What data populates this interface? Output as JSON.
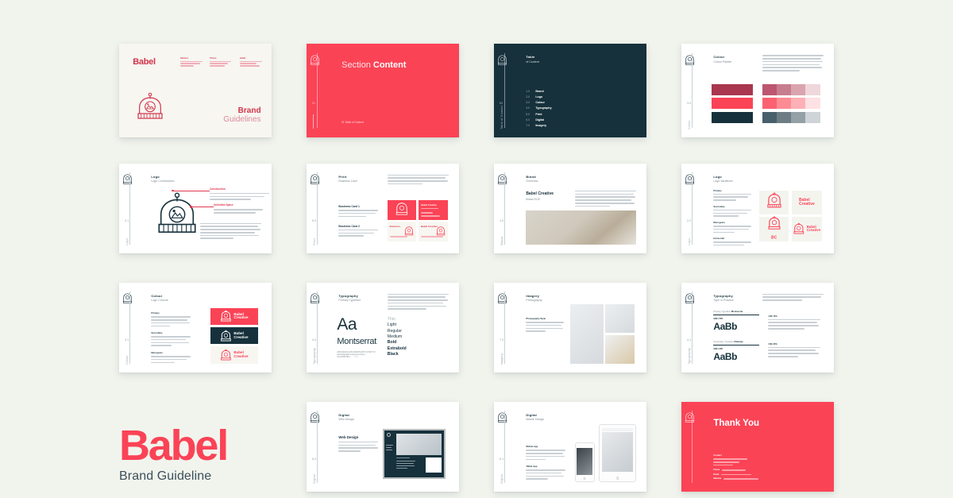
{
  "page": {
    "background": "#f1f4ed",
    "accent_red": "#fb4356",
    "accent_maroon": "#a9374f",
    "accent_navy": "#16313c"
  },
  "footer": {
    "brand": "Babel",
    "subtitle": "Brand Guideline"
  },
  "slides": {
    "cover": {
      "brand": "Babel",
      "title_line1": "Brand",
      "title_line2": "Guidelines",
      "columns": [
        {
          "label": "Address"
        },
        {
          "label": "Phone"
        },
        {
          "label": "Email"
        }
      ]
    },
    "section": {
      "title_light": "Section ",
      "title_bold": "Content",
      "footer": "01 Table of Content",
      "number": "01"
    },
    "toc": {
      "heading_line1": "Table",
      "heading_line2": "of Content",
      "number": "01",
      "vertical_label": "Table of Content",
      "items": [
        {
          "num": "1.0",
          "label": "Brand"
        },
        {
          "num": "2.0",
          "label": "Logo"
        },
        {
          "num": "3.0",
          "label": "Colour"
        },
        {
          "num": "4.0",
          "label": "Typography"
        },
        {
          "num": "5.0",
          "label": "Print"
        },
        {
          "num": "6.0",
          "label": "Digital"
        },
        {
          "num": "7.0",
          "label": "Imagery"
        }
      ]
    },
    "colour": {
      "heading_line1": "Colour",
      "heading_line2": "Colour Palette",
      "number": "3.0",
      "vertical_label": "Colour",
      "main_swatches": [
        "#a9374f",
        "#fb4356",
        "#16313c"
      ],
      "tints": [
        [
          "#bd5670",
          "#c87d8f",
          "#d9a4ad",
          "#efd7dc"
        ],
        [
          "#fb6170",
          "#fc8b94",
          "#fdb0b6",
          "#fee1e3"
        ],
        [
          "#47606c",
          "#6e7d85",
          "#94a0a6",
          "#ced4d8"
        ]
      ]
    },
    "logo_construction": {
      "heading_line1": "Logo",
      "heading_line2": "Logo Construction",
      "number": "2.1",
      "vertical_label": "Logo",
      "callout_1": "Construction",
      "callout_2": "Unlimited Space"
    },
    "business_card": {
      "heading_line1": "Print",
      "heading_line2": "Business Card",
      "number": "5.0",
      "vertical_label": "Print",
      "section_1": "Business Card 1",
      "section_2": "Business Card 2",
      "card_front_name": "Babel Creative",
      "card_back_a": "Business",
      "card_back_b": "Babel Creative"
    },
    "brand_intro": {
      "heading_line1": "Brand",
      "heading_line2": "Overview",
      "number": "1.0",
      "vertical_label": "Brand",
      "title": "Babel Creative",
      "subtitle": "Brand 2019"
    },
    "logo_variations": {
      "heading_line1": "Logo",
      "heading_line2": "Logo Variations",
      "number": "2.2",
      "vertical_label": "Logo",
      "blocks": [
        "Primary",
        "Secondary",
        "Monogram",
        "Horizontal"
      ],
      "wordmark_line1": "Babel",
      "wordmark_line2": "Creative",
      "monogram": "BC"
    },
    "logo_colours": {
      "heading_line1": "Colour",
      "heading_line2": "Logo Colours",
      "number": "3.1",
      "vertical_label": "Colour",
      "blocks": [
        "Primary",
        "Secondary",
        "Monogram"
      ],
      "lockup_line1": "Babel",
      "lockup_line2": "Creative"
    },
    "typography": {
      "heading_line1": "Typography",
      "heading_line2": "Primary Typeface",
      "number": "4.0",
      "vertical_label": "Typography",
      "sample": "Aa",
      "family": "Montserrat",
      "glyphs_line1": "ABCDEFGHIJKLMNOPQRSTUVWXYZ",
      "glyphs_line2": "abcdefghijklmnopqrstuvwxyz",
      "glyphs_line3": "0123456789 ( . , ! ? )",
      "weights": [
        "Thin",
        "Light",
        "Regular",
        "Medium",
        "Bold",
        "Extrabold",
        "Black"
      ]
    },
    "type_pairing": {
      "heading_line1": "Typography",
      "heading_line2": "Type in Practice",
      "number": "4.1",
      "vertical_label": "Typography",
      "row1_label": "Primary Typeface",
      "row1_value": "Montserrat",
      "row1_size": "SIZE 17PX",
      "row1_sample": "AaBb",
      "row2_label": "Secondary Typeface",
      "row2_value": "Raleway",
      "row2_size": "SIZE 11PX",
      "row2_sample": "AaBb",
      "note1": "USE 70%",
      "note2": "USE 30%"
    },
    "imagery": {
      "heading_line1": "Imagery",
      "heading_line2": "Photography",
      "number": "7.0",
      "vertical_label": "Imagery",
      "block_label": "Photography Style"
    },
    "web_design": {
      "heading_line1": "Digital",
      "heading_line2": "Web Design",
      "number": "6.0",
      "vertical_label": "Digital",
      "title": "Web Design"
    },
    "mobile_design": {
      "heading_line1": "Digital",
      "heading_line2": "Mobile Design",
      "number": "6.1",
      "vertical_label": "Digital",
      "section_1": "Mobile App",
      "section_2": "Tablet App"
    },
    "thank_you": {
      "title": "Thank You",
      "contact_label": "Contact",
      "phone_label": "Phone",
      "email_label": "Email",
      "web_label": "Website"
    }
  }
}
